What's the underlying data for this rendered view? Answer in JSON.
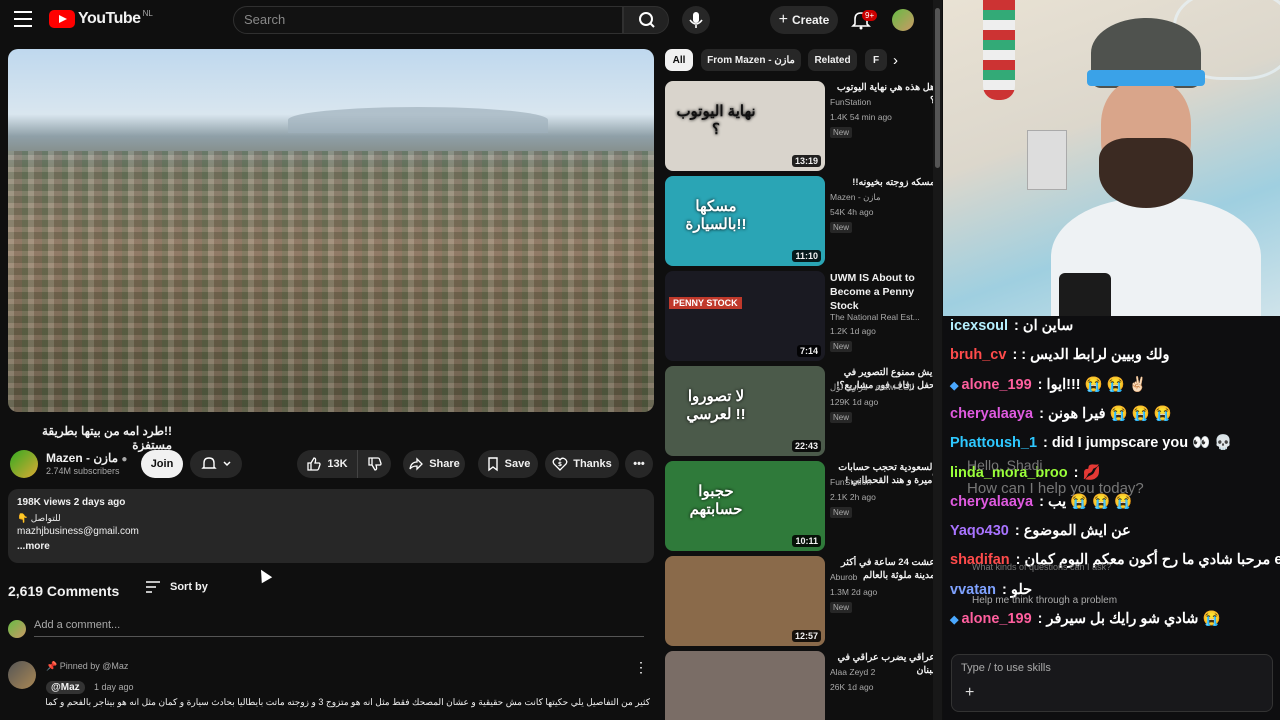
{
  "header": {
    "logo_text": "YouTube",
    "country_code": "NL",
    "search_placeholder": "Search",
    "create_label": "Create",
    "notif_count": "9+"
  },
  "video": {
    "title": "!!طرد امه من بيتها بطريقة مستفزة",
    "channel": "Mazen - مازن",
    "subscribers": "2.74M subscribers",
    "join_label": "Join",
    "like_count": "13K",
    "share_label": "Share",
    "save_label": "Save",
    "thanks_label": "Thanks"
  },
  "description": {
    "stats": "198K views  2 days ago",
    "line1": "👇 للتواصل",
    "email": "mazhjbusiness@gmail.com",
    "more": "...more"
  },
  "comments": {
    "count": "2,619 Comments",
    "sort_label": "Sort by",
    "add_placeholder": "Add a comment...",
    "pinned_by": "Pinned by @Maz",
    "author": "@Maz",
    "time": "1 day ago",
    "text": "كثير من التفاصيل يلي حكيتها كانت مش حقيقية و عشان المصحك فقط مثل انه هو متزوج 3 و زوجته ماتت بايطاليا بحادث سيارة و كمان مثل انه هو بيتاجر بالفحم و كمان عمره انا ما بعرف لو"
  },
  "chips": [
    "All",
    "From Mazen - مازن",
    "Related",
    "F"
  ],
  "related": [
    {
      "title": "هل هذه هي نهاية اليوتوب ؟",
      "ltr": false,
      "channel": "FunStation",
      "verified": true,
      "meta": "1.4K  54 min ago",
      "new": "New",
      "duration": "13:19",
      "thumb_text": "نهاية اليوتوب ؟",
      "bg": "#d9d4cc"
    },
    {
      "title": "مسكه زوجته بخيونه!!",
      "ltr": false,
      "channel": "Mazen - مازن",
      "verified": true,
      "meta": "54K  4h ago",
      "new": "New",
      "duration": "11:10",
      "thumb_text": "مسكها بالسيارة!!",
      "bg": "#2aa5b5"
    },
    {
      "title": "UWM IS About to Become a Penny Stock",
      "ltr": true,
      "channel": "The National Real Est...",
      "verified": false,
      "meta": "1.2K  1d ago",
      "new": "New",
      "duration": "7:14",
      "thumb_text": "PENNY STOCK",
      "bg": "#1a1a22"
    },
    {
      "title": "ايش ممنوع التصوير في حفل زفاف فور مشاريع؟!",
      "ltr": false,
      "channel": "مراوي لول - arawi LOL",
      "verified": false,
      "meta": "129K  1d ago",
      "new": "New",
      "duration": "22:43",
      "thumb_text": "لا تصوروا لعرسي !!",
      "bg": "#4b5a4a"
    },
    {
      "title": "السعودية تحجب حسابات أميرة و هند القحطاني !",
      "ltr": false,
      "channel": "FunStation",
      "verified": true,
      "meta": "2.1K  2h ago",
      "new": "New",
      "duration": "10:11",
      "thumb_text": "حجبوا حسابتهم",
      "bg": "#2f7a3a"
    },
    {
      "title": "عشت 24 ساعة في أكثر مدينة ملوثة بالعالم",
      "ltr": false,
      "channel": "Aburob",
      "verified": true,
      "meta": "1.3M  2d ago",
      "new": "New",
      "duration": "12:57",
      "thumb_text": "",
      "bg": "#8a6a4a"
    },
    {
      "title": "عراقي يضرب عراقي في لبنان",
      "ltr": false,
      "channel": "Alaa Zeyd 2",
      "verified": false,
      "meta": "26K  1d ago",
      "new": "",
      "duration": "",
      "thumb_text": "",
      "bg": "#7a6d66"
    }
  ],
  "chat": {
    "messages": [
      {
        "user": "icexsoul",
        "color": "#b5f0ff",
        "text": " : ساين ان",
        "badge": false
      },
      {
        "user": "bruh_cv",
        "color": "#ff4b4b",
        "text": " : : ولك وبيين لرابط الديس",
        "badge": false
      },
      {
        "user": "alone_199",
        "color": "#ff5f9e",
        "text": " : ايوا!!! 😭 😭 ✌🏻",
        "badge": true
      },
      {
        "user": "cheryalaaya",
        "color": "#e05ae0",
        "text": " : فيرا هونن 😭 😭 😭",
        "badge": false
      },
      {
        "user": "Phattoush_1",
        "color": "#2ec8ff",
        "text": " : did I jumpscare you 👀 💀",
        "badge": false
      },
      {
        "user": "linda_mora_broo",
        "color": "#9aff3a",
        "text": " : 💋",
        "badge": false
      },
      {
        "user": "cheryalaaya",
        "color": "#e05ae0",
        "text": " : يب 😭 😭 😭",
        "badge": false
      },
      {
        "user": "Yaqo430",
        "color": "#a873ff",
        "text": " : عن ايش الموضوع",
        "badge": false
      },
      {
        "user": "shadifan",
        "color": "#ff4b4b",
        "text": " : مرحبا شادي ما رح أكون معكم اليوم كمان enjoy",
        "badge": false
      },
      {
        "user": "vvatan",
        "color": "#7fa2ff",
        "text": " : حلو",
        "badge": false
      },
      {
        "user": "alone_199",
        "color": "#ff5f9e",
        "text": " : شادي شو رايك بل سيرفر 😭",
        "badge": true
      }
    ],
    "ghost_hello": "Hello, Shadi",
    "ghost_help": "How can I help you today?",
    "ghost_q1": "What kinds of questions can I ask?",
    "ghost_q2": "Help me think through a problem",
    "placeholder": "Type / to use skills"
  }
}
